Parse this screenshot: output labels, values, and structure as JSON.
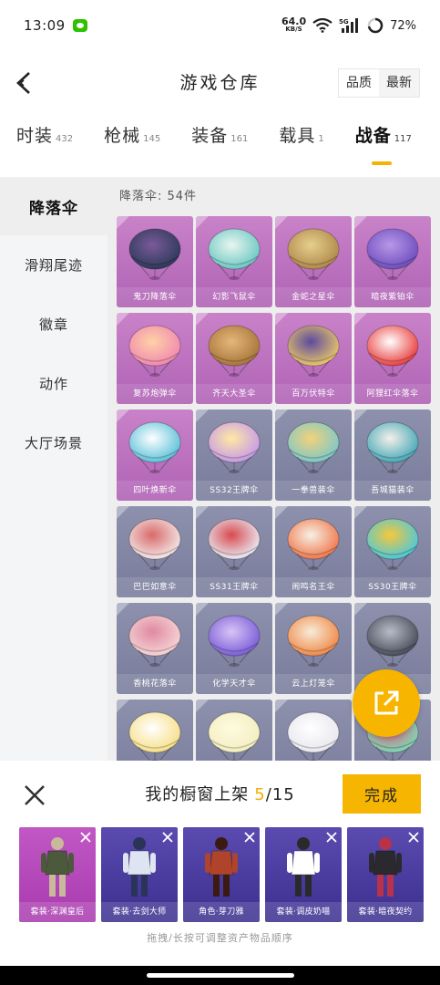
{
  "status": {
    "time": "13:09",
    "net_speed_value": "64.0",
    "net_speed_unit": "KB/S",
    "network_type": "5G",
    "battery": "72%"
  },
  "header": {
    "title": "游戏仓库",
    "sort_options": [
      "品质",
      "最新"
    ]
  },
  "category_tabs": [
    {
      "name": "时装",
      "count": "432"
    },
    {
      "name": "枪械",
      "count": "145"
    },
    {
      "name": "装备",
      "count": "161"
    },
    {
      "name": "载具",
      "count": "1"
    },
    {
      "name": "战备",
      "count": "117"
    }
  ],
  "sidebar": {
    "items": [
      "降落伞",
      "滑翔尾迹",
      "徽章",
      "动作",
      "大厅场景"
    ]
  },
  "list": {
    "title": "降落伞: 54件",
    "items": [
      {
        "name": "鬼刀降落伞",
        "rarity": "pink",
        "c1": "#2e3b5a",
        "c2": "#7a5a9a"
      },
      {
        "name": "幻影飞鼠伞",
        "rarity": "pink",
        "c1": "#6ec9c4",
        "c2": "#e9f5f0"
      },
      {
        "name": "金蛇之星伞",
        "rarity": "pink",
        "c1": "#b08a4a",
        "c2": "#e6cf8f"
      },
      {
        "name": "暗夜紫铂伞",
        "rarity": "pink",
        "c1": "#6f4fbf",
        "c2": "#b898e8"
      },
      {
        "name": "复苏炮弹伞",
        "rarity": "pink",
        "c1": "#f08ab0",
        "c2": "#ffd2a6"
      },
      {
        "name": "齐天大圣伞",
        "rarity": "pink",
        "c1": "#a8763c",
        "c2": "#e5b77a"
      },
      {
        "name": "百万伏特伞",
        "rarity": "pink",
        "c1": "#e6c46b",
        "c2": "#5d4a9e"
      },
      {
        "name": "阿狸红伞落伞",
        "rarity": "pink",
        "c1": "#e8413f",
        "c2": "#ffffff"
      },
      {
        "name": "四叶焕新伞",
        "rarity": "pink",
        "c1": "#5fc2d9",
        "c2": "#ffffff"
      },
      {
        "name": "SS32王牌伞",
        "rarity": "blue",
        "c1": "#c79be8",
        "c2": "#ffe9a3"
      },
      {
        "name": "一拳兽装伞",
        "rarity": "blue",
        "c1": "#7ec8c8",
        "c2": "#f3d27a"
      },
      {
        "name": "吾城猫装伞",
        "rarity": "blue",
        "c1": "#4aa9b8",
        "c2": "#f4f0ea"
      },
      {
        "name": "巴巴如意伞",
        "rarity": "blue",
        "c1": "#f3e6e6",
        "c2": "#d96a6a"
      },
      {
        "name": "SS31王牌伞",
        "rarity": "blue",
        "c1": "#e9e9f2",
        "c2": "#d84b50"
      },
      {
        "name": "闹鸣名王伞",
        "rarity": "blue",
        "c1": "#f07a4e",
        "c2": "#f7f0e6"
      },
      {
        "name": "SS30王牌伞",
        "rarity": "blue",
        "c1": "#4ec9d9",
        "c2": "#f7c83a"
      },
      {
        "name": "香桃花落伞",
        "rarity": "blue",
        "c1": "#f5d3d6",
        "c2": "#e08aa0"
      },
      {
        "name": "化学天才伞",
        "rarity": "blue",
        "c1": "#7b5fd8",
        "c2": "#d9c4f6"
      },
      {
        "name": "云上灯笼伞",
        "rarity": "blue",
        "c1": "#f08a4a",
        "c2": "#f7ecd8"
      },
      {
        "name": "",
        "rarity": "blue",
        "c1": "#4a4e5c",
        "c2": "#b8bcc8"
      },
      {
        "name": "",
        "rarity": "blue",
        "c1": "#f7e08a",
        "c2": "#ffffff"
      },
      {
        "name": "",
        "rarity": "blue",
        "c1": "#f3eec0",
        "c2": "#fffbe0"
      },
      {
        "name": "",
        "rarity": "blue",
        "c1": "#e8e8ee",
        "c2": "#ffffff"
      },
      {
        "name": "",
        "rarity": "blue",
        "c1": "#7fd6b6",
        "c2": "#e85a7a"
      }
    ]
  },
  "showcase": {
    "title": "我的橱窗上架",
    "count": "5",
    "max": "15",
    "done_label": "完成",
    "items": [
      {
        "label": "套装·深渊皇后",
        "c1": "#4b5a3a",
        "c2": "#c9b89a"
      },
      {
        "label": "套装·去剑大师",
        "c1": "#dfe4f2",
        "c2": "#2a3358"
      },
      {
        "label": "角色·芽刀雅",
        "c1": "#b0442a",
        "c2": "#3a1a12"
      },
      {
        "label": "套装·调皮奶喵",
        "c1": "#ffffff",
        "c2": "#2a2a2a"
      },
      {
        "label": "套装·暗夜契约",
        "c1": "#2a2a2e",
        "c2": "#b8334a"
      }
    ],
    "hint": "拖拽/长按可调整资产物品顺序"
  },
  "colors": {
    "accent": "#f6b500",
    "rarity_pink": "#b96fbd",
    "rarity_blue": "#83869f"
  },
  "icons": {
    "back": "chevron-left-icon",
    "share": "share-external-icon",
    "close": "close-icon",
    "remove": "remove-x-icon"
  }
}
